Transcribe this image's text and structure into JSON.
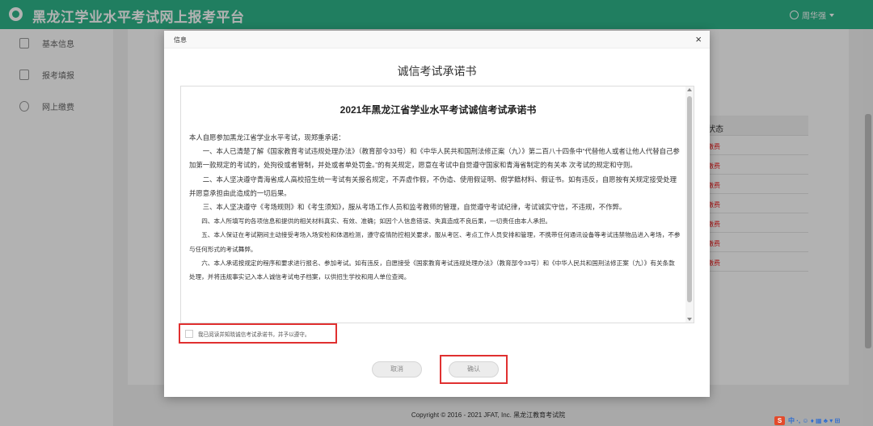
{
  "app": {
    "title": "黑龙江学业水平考试网上报考平台",
    "user": "周华强"
  },
  "sidebar": {
    "items": [
      {
        "label": "基本信息",
        "icon": "form-icon"
      },
      {
        "label": "报考填报",
        "icon": "edit-icon"
      },
      {
        "label": "网上缴费",
        "icon": "payment-icon"
      }
    ]
  },
  "background_table": {
    "header": "状态",
    "cells": [
      "缴费",
      "缴费",
      "缴费",
      "缴费",
      "缴费",
      "缴费",
      "缴费"
    ]
  },
  "footer": {
    "copyright": "Copyright © 2016 - 2021 JFAT, Inc. 黑龙江教育考试院"
  },
  "dialog": {
    "title": "信息",
    "close_glyph": "×",
    "heading": "诚信考试承诺书",
    "doc_title": "2021年黑龙江省学业水平考试诚信考试承诺书",
    "paragraphs": [
      "本人自愿参加黑龙江省学业水平考试，现郑重承诺：",
      "一、本人已清楚了解《国家教育考试违规处理办法》（教育部令33号）和《中华人民共和国刑法修正案（九）》第二百八十四条中“代替他人或者让他人代替自己参加第一款规定的考试的，处拘役或者管制，并处或者单处罚金。”的有关规定，愿意在考试中自觉遵守国家和青海省制定的有关本 次考试的规定和守则。",
      "二、本人坚决遵守青海省成人高校招生统一考试有关报名规定，不弄虚作假，不伪造、使用假证明、假学籍材料、假证书。如有违反，自愿按有关规定接受处理并愿意承担由此造成的一切后果。",
      "三、本人坚决遵守《考场规则》和《考生须知》，服从考场工作人员和监考教师的管理，自觉遵守考试纪律，考试诚实守信，不违规，不作弊。",
      "四、本人所填写的各项信息和提供的相关材料真实、有效、准确；如因个人信息错误、失真造成不良后果，一切责任由本人承担。",
      "五、本人保证在考试期间主动接受考场入场安检和体温检测，遵守疫情防控相关要求，服从考区、考点工作人员安排和管理，不携带任何通讯设备等考试违禁物品进入考场，不参与任何形式的考试舞弊。",
      "六、本人承诺按规定的程序和要求进行报名、参加考试。如有违反，自愿接受《国家教育考试违规处理办法》（教育部令33号）和《中华人民共和国刑法修正案（九）》有关条款处理，并将违规事实记入本人诚信考试电子档案，以供招生学校和用人单位查阅。"
    ],
    "agree_label": "我已阅读并知晓诚信考试承诺书，并予以遵守。",
    "cancel_label": "取消",
    "confirm_label": "确认"
  },
  "taskbar": {
    "ime_logo": "S",
    "ime_text": "中 ·, ☺ ♦ ▦ ♣ ▾ ⊞"
  },
  "colors": {
    "brand": "#2fb58a",
    "highlight": "#e03030"
  }
}
